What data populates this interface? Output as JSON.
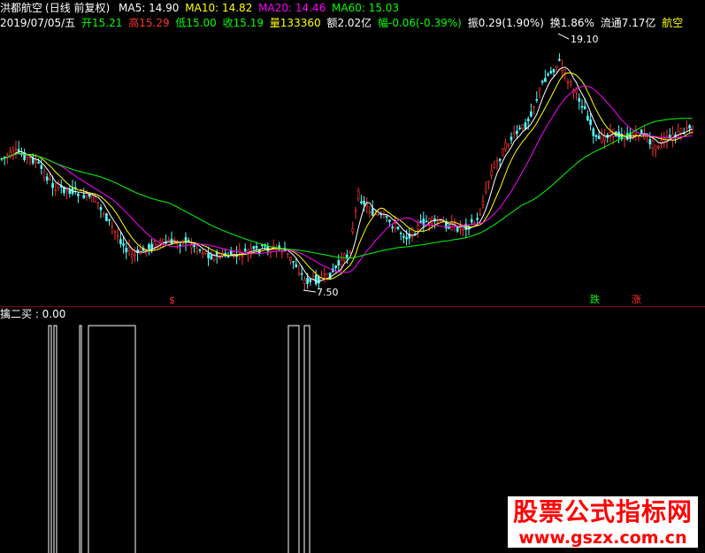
{
  "header": {
    "stock": "洪都航空",
    "period": "(日线 前复权)",
    "ma5_label": "MA5: 14.90",
    "ma10_label": "MA10: 14.82",
    "ma20_label": "MA20: 14.46",
    "ma60_label": "MA60: 15.03",
    "date": "2019/07/05/五",
    "open": "开15.21",
    "high": "高15.29",
    "low": "低15.00",
    "close": "收15.19",
    "volume": "量133360",
    "amount": "额2.02亿",
    "change": "幅-0.06(-0.39%)",
    "amplitude": "振0.29(1.90%)",
    "turnover": "换1.86%",
    "float_cap": "流通7.17亿",
    "sector": "航空"
  },
  "annotations": {
    "high_label": "19.10",
    "low_label": "7.50",
    "signal_s": "$",
    "tag_down": "跌",
    "tag_up": "涨"
  },
  "indicator": {
    "label": "擒二买 : 0.00"
  },
  "watermark": {
    "title": "股票公式指标网",
    "url": "www.gszx.com.cn"
  },
  "colors": {
    "up": "#ff3232",
    "down": "#54ffff",
    "ma5": "#ffffff",
    "ma10": "#ffff00",
    "ma20": "#ff00ff",
    "ma60": "#00ff00",
    "text_green": "#00ff00",
    "text_red": "#ff3232",
    "text_white": "#ffffff",
    "text_yellow": "#ffff00"
  }
}
